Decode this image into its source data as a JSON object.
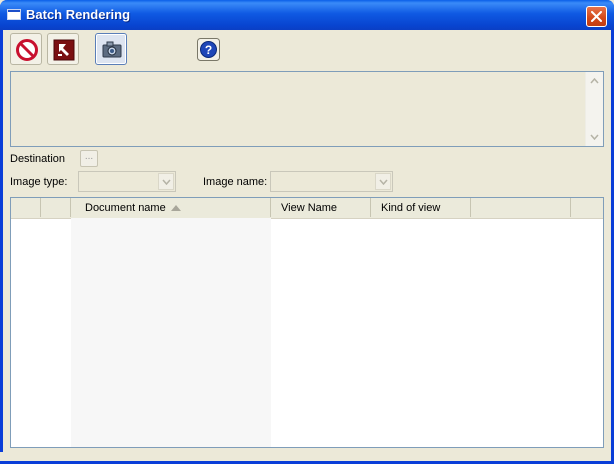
{
  "window": {
    "title": "Batch Rendering"
  },
  "toolbar": {
    "buttons": [
      {
        "name": "stop",
        "icon": "stop-icon"
      },
      {
        "name": "render-settings",
        "icon": "render-icon"
      },
      {
        "name": "snapshot",
        "icon": "camera-icon",
        "state": "pressed"
      },
      {
        "name": "help",
        "icon": "help-icon"
      }
    ]
  },
  "form": {
    "destination_label": "Destination",
    "browse_label": "...",
    "image_type_label": "Image type:",
    "image_type_value": "",
    "image_name_label": "Image name:",
    "image_name_value": ""
  },
  "table": {
    "columns": [
      {
        "label": ""
      },
      {
        "label": ""
      },
      {
        "label": "Document name",
        "sorted": "ascending"
      },
      {
        "label": "View Name"
      },
      {
        "label": "Kind of view"
      },
      {
        "label": ""
      }
    ],
    "rows": []
  },
  "colors": {
    "titlebar": "#0a4fd8",
    "window_bg": "#ece9d8",
    "border": "#7f9db9",
    "stop_red": "#c8102e"
  }
}
